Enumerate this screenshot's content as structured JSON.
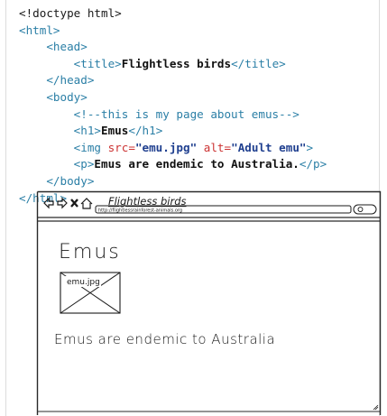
{
  "code": {
    "line1": "<!doctype html>",
    "html_open": "<html>",
    "head_open": "<head>",
    "title_open": "<title>",
    "title_text": "Flightless birds",
    "title_close": "</title>",
    "head_close": "</head>",
    "body_open": "<body>",
    "comment": "<!--this is my page about emus-->",
    "h1_open": "<h1>",
    "h1_text": "Emus",
    "h1_close": "</h1>",
    "img_open": "<img ",
    "src_attr": "src=",
    "src_value": "\"emu.jpg\"",
    "alt_attr": " alt=",
    "alt_value": "\"Adult emu\"",
    "img_close": ">",
    "p_open": "<p>",
    "p_text": "Emus are endemic to Australia.",
    "p_close": "</p>",
    "body_close": "</body>",
    "html_close": "</html>"
  },
  "sketch": {
    "nav_icons": [
      "back-arrow",
      "forward-arrow",
      "stop-x",
      "home"
    ],
    "tab_title": "Flightless birds",
    "url": "http://flightlessrainforest-animals.org",
    "heading": "Emus",
    "image_label": "emu.jpg",
    "paragraph": "Emus are endemic to Australia"
  }
}
